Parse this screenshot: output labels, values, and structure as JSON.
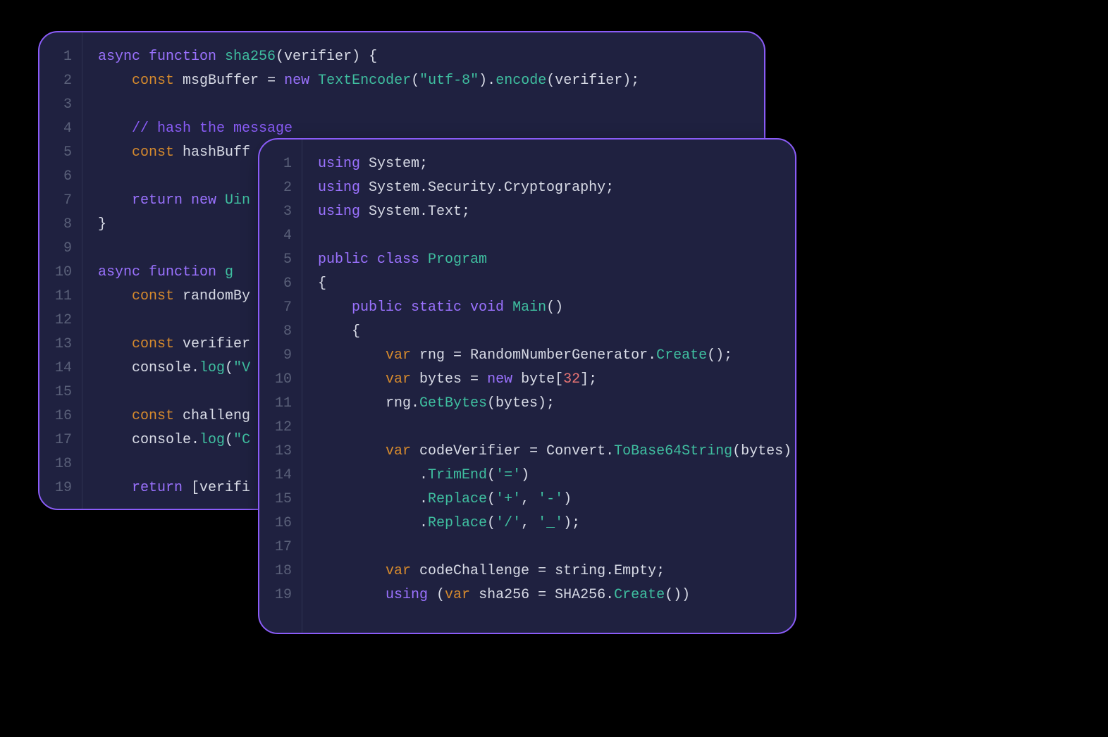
{
  "back_panel": {
    "language": "javascript",
    "lines": [
      [
        {
          "c": "kw",
          "t": "async function "
        },
        {
          "c": "fn",
          "t": "sha256"
        },
        {
          "c": "pl",
          "t": "(verifier) {"
        }
      ],
      [
        {
          "c": "pl",
          "t": "    "
        },
        {
          "c": "decl",
          "t": "const"
        },
        {
          "c": "pl",
          "t": " msgBuffer "
        },
        {
          "c": "op",
          "t": "="
        },
        {
          "c": "pl",
          "t": " "
        },
        {
          "c": "kw",
          "t": "new "
        },
        {
          "c": "fn",
          "t": "TextEncoder"
        },
        {
          "c": "pl",
          "t": "("
        },
        {
          "c": "str",
          "t": "\"utf-8\""
        },
        {
          "c": "pl",
          "t": ")."
        },
        {
          "c": "fn",
          "t": "encode"
        },
        {
          "c": "pl",
          "t": "(verifier);"
        }
      ],
      [],
      [
        {
          "c": "pl",
          "t": "    "
        },
        {
          "c": "cmt",
          "t": "// hash the message"
        }
      ],
      [
        {
          "c": "pl",
          "t": "    "
        },
        {
          "c": "decl",
          "t": "const"
        },
        {
          "c": "pl",
          "t": " hashBuff"
        }
      ],
      [],
      [
        {
          "c": "pl",
          "t": "    "
        },
        {
          "c": "kw",
          "t": "return new "
        },
        {
          "c": "fn",
          "t": "Uin"
        }
      ],
      [
        {
          "c": "pl",
          "t": "}"
        }
      ],
      [],
      [
        {
          "c": "kw",
          "t": "async function "
        },
        {
          "c": "fn",
          "t": "g"
        }
      ],
      [
        {
          "c": "pl",
          "t": "    "
        },
        {
          "c": "decl",
          "t": "const"
        },
        {
          "c": "pl",
          "t": " randomBy"
        }
      ],
      [],
      [
        {
          "c": "pl",
          "t": "    "
        },
        {
          "c": "decl",
          "t": "const"
        },
        {
          "c": "pl",
          "t": " verifier"
        }
      ],
      [
        {
          "c": "pl",
          "t": "    console."
        },
        {
          "c": "fn",
          "t": "log"
        },
        {
          "c": "pl",
          "t": "("
        },
        {
          "c": "str",
          "t": "\"V"
        }
      ],
      [],
      [
        {
          "c": "pl",
          "t": "    "
        },
        {
          "c": "decl",
          "t": "const"
        },
        {
          "c": "pl",
          "t": " challeng"
        }
      ],
      [
        {
          "c": "pl",
          "t": "    console."
        },
        {
          "c": "fn",
          "t": "log"
        },
        {
          "c": "pl",
          "t": "("
        },
        {
          "c": "str",
          "t": "\"C"
        }
      ],
      [],
      [
        {
          "c": "pl",
          "t": "    "
        },
        {
          "c": "kw",
          "t": "return"
        },
        {
          "c": "pl",
          "t": " [verifi"
        }
      ]
    ]
  },
  "front_panel": {
    "language": "csharp",
    "lines": [
      [
        {
          "c": "kw",
          "t": "using"
        },
        {
          "c": "pl",
          "t": " System;"
        }
      ],
      [
        {
          "c": "kw",
          "t": "using"
        },
        {
          "c": "pl",
          "t": " System.Security.Cryptography;"
        }
      ],
      [
        {
          "c": "kw",
          "t": "using"
        },
        {
          "c": "pl",
          "t": " System.Text;"
        }
      ],
      [],
      [
        {
          "c": "kw",
          "t": "public class "
        },
        {
          "c": "fn",
          "t": "Program"
        }
      ],
      [
        {
          "c": "pl",
          "t": "{"
        }
      ],
      [
        {
          "c": "pl",
          "t": "    "
        },
        {
          "c": "kw",
          "t": "public static void "
        },
        {
          "c": "fn",
          "t": "Main"
        },
        {
          "c": "pl",
          "t": "()"
        }
      ],
      [
        {
          "c": "pl",
          "t": "    {"
        }
      ],
      [
        {
          "c": "pl",
          "t": "        "
        },
        {
          "c": "decl",
          "t": "var"
        },
        {
          "c": "pl",
          "t": " rng "
        },
        {
          "c": "op",
          "t": "="
        },
        {
          "c": "pl",
          "t": " RandomNumberGenerator."
        },
        {
          "c": "fn",
          "t": "Create"
        },
        {
          "c": "pl",
          "t": "();"
        }
      ],
      [
        {
          "c": "pl",
          "t": "        "
        },
        {
          "c": "decl",
          "t": "var"
        },
        {
          "c": "pl",
          "t": " bytes "
        },
        {
          "c": "op",
          "t": "="
        },
        {
          "c": "pl",
          "t": " "
        },
        {
          "c": "kw",
          "t": "new"
        },
        {
          "c": "pl",
          "t": " byte["
        },
        {
          "c": "num",
          "t": "32"
        },
        {
          "c": "pl",
          "t": "];"
        }
      ],
      [
        {
          "c": "pl",
          "t": "        rng."
        },
        {
          "c": "fn",
          "t": "GetBytes"
        },
        {
          "c": "pl",
          "t": "(bytes);"
        }
      ],
      [],
      [
        {
          "c": "pl",
          "t": "        "
        },
        {
          "c": "decl",
          "t": "var"
        },
        {
          "c": "pl",
          "t": " codeVerifier "
        },
        {
          "c": "op",
          "t": "="
        },
        {
          "c": "pl",
          "t": " Convert."
        },
        {
          "c": "fn",
          "t": "ToBase64String"
        },
        {
          "c": "pl",
          "t": "(bytes)"
        }
      ],
      [
        {
          "c": "pl",
          "t": "            ."
        },
        {
          "c": "fn",
          "t": "TrimEnd"
        },
        {
          "c": "pl",
          "t": "("
        },
        {
          "c": "str",
          "t": "'='"
        },
        {
          "c": "pl",
          "t": ")"
        }
      ],
      [
        {
          "c": "pl",
          "t": "            ."
        },
        {
          "c": "fn",
          "t": "Replace"
        },
        {
          "c": "pl",
          "t": "("
        },
        {
          "c": "str",
          "t": "'+'"
        },
        {
          "c": "pl",
          "t": ", "
        },
        {
          "c": "str",
          "t": "'-'"
        },
        {
          "c": "pl",
          "t": ")"
        }
      ],
      [
        {
          "c": "pl",
          "t": "            ."
        },
        {
          "c": "fn",
          "t": "Replace"
        },
        {
          "c": "pl",
          "t": "("
        },
        {
          "c": "str",
          "t": "'/'"
        },
        {
          "c": "pl",
          "t": ", "
        },
        {
          "c": "str",
          "t": "'_'"
        },
        {
          "c": "pl",
          "t": ");"
        }
      ],
      [],
      [
        {
          "c": "pl",
          "t": "        "
        },
        {
          "c": "decl",
          "t": "var"
        },
        {
          "c": "pl",
          "t": " codeChallenge "
        },
        {
          "c": "op",
          "t": "="
        },
        {
          "c": "pl",
          "t": " string.Empty;"
        }
      ],
      [
        {
          "c": "pl",
          "t": "        "
        },
        {
          "c": "kw",
          "t": "using"
        },
        {
          "c": "pl",
          "t": " ("
        },
        {
          "c": "decl",
          "t": "var"
        },
        {
          "c": "pl",
          "t": " sha256 "
        },
        {
          "c": "op",
          "t": "="
        },
        {
          "c": "pl",
          "t": " SHA256."
        },
        {
          "c": "fn",
          "t": "Create"
        },
        {
          "c": "pl",
          "t": "())"
        }
      ]
    ]
  }
}
